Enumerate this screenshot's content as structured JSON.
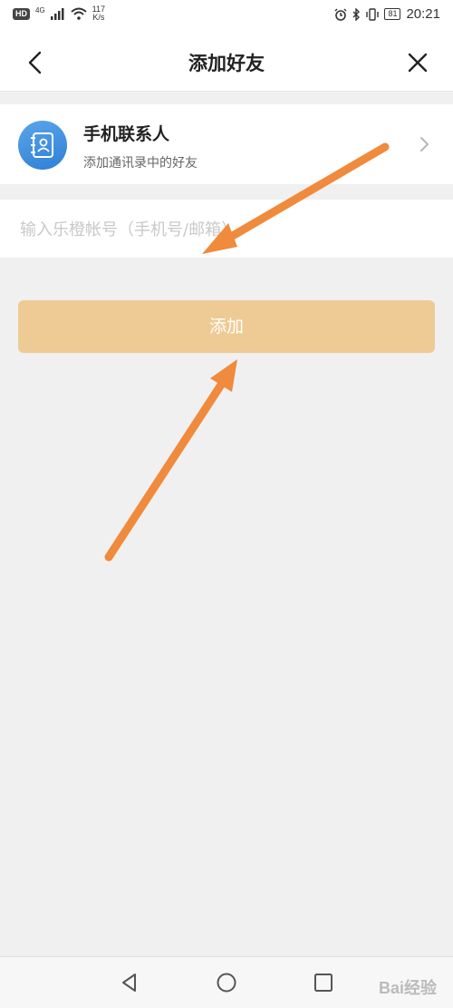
{
  "status_bar": {
    "hd_badge": "HD",
    "network_type": "4G",
    "speed_value": "117",
    "speed_unit": "K/s",
    "battery": "81",
    "time": "20:21",
    "icons": [
      "signal-icon",
      "wifi-icon",
      "alarm-icon",
      "bluetooth-icon",
      "vibrate-icon",
      "battery-icon"
    ]
  },
  "app_bar": {
    "title": "添加好友",
    "back_icon": "chevron-left-icon",
    "close_icon": "close-icon"
  },
  "phone_contacts": {
    "title": "手机联系人",
    "subtitle": "添加通讯录中的好友",
    "icon": "contacts-book-icon",
    "chevron": "chevron-right-icon"
  },
  "account_input": {
    "value": "",
    "placeholder": "输入乐橙帐号（手机号/邮箱）"
  },
  "add_button": {
    "label": "添加",
    "color": "#eecb94"
  },
  "annotation": {
    "arrow_color": "#f08a3c"
  },
  "nav_bar": {
    "icons": [
      "nav-back-icon",
      "nav-home-icon",
      "nav-recents-icon"
    ]
  },
  "watermark": {
    "text": "Bai经验"
  }
}
